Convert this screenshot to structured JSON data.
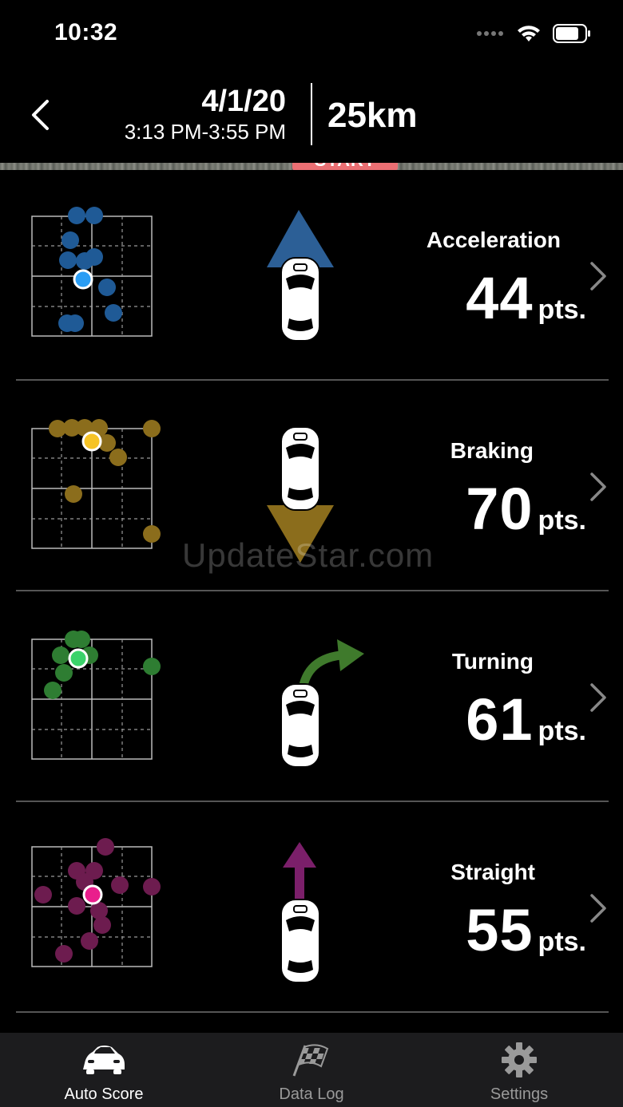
{
  "status_bar": {
    "time": "10:32",
    "icons": [
      "signal-dots-icon",
      "wifi-icon",
      "battery-icon"
    ]
  },
  "header": {
    "back_icon": "chevron-left-icon",
    "date": "4/1/20",
    "time_range": "3:13 PM-3:55 PM",
    "distance": "25km"
  },
  "map": {
    "start_label": "START"
  },
  "scores": [
    {
      "label": "Acceleration",
      "value": "44",
      "unit": "pts.",
      "color": "#1f5a96",
      "highlight": "#2a9df4",
      "graphic": "up-triangle-car-icon"
    },
    {
      "label": "Braking",
      "value": "70",
      "unit": "pts.",
      "color": "#8b6d1c",
      "highlight": "#f6c325",
      "graphic": "down-triangle-car-icon"
    },
    {
      "label": "Turning",
      "value": "61",
      "unit": "pts.",
      "color": "#2e7d32",
      "highlight": "#3ad36a",
      "graphic": "turn-arrow-car-icon"
    },
    {
      "label": "Straight",
      "value": "55",
      "unit": "pts.",
      "color": "#6d1c4f",
      "highlight": "#e91e8c",
      "graphic": "up-arrow-car-icon"
    }
  ],
  "tabs": [
    {
      "label": "Auto Score",
      "icon": "car-icon",
      "active": true
    },
    {
      "label": "Data Log",
      "icon": "checkered-flag-icon",
      "active": false
    },
    {
      "label": "Settings",
      "icon": "gear-icon",
      "active": false
    }
  ],
  "watermark": "UpdateStar.com"
}
